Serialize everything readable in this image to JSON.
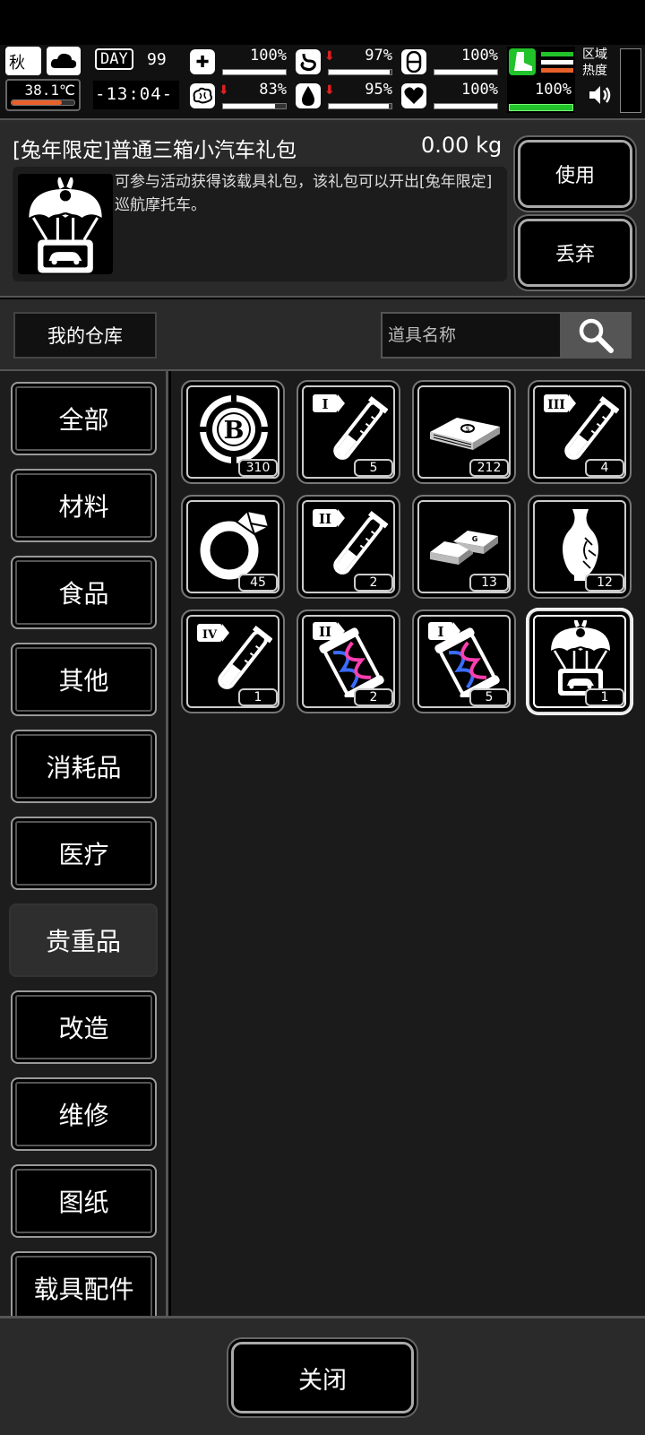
{
  "hud": {
    "season": "秋",
    "temperature": "38.1℃",
    "day_label": "DAY",
    "day": "99",
    "time": "-13:04-",
    "stats": [
      {
        "name": "health",
        "icon": "medkit-icon",
        "value": "100%",
        "fill": 1.0,
        "down": false
      },
      {
        "name": "stomach",
        "icon": "stomach-icon",
        "value": "97%",
        "fill": 0.97,
        "down": true
      },
      {
        "name": "stamina",
        "icon": "capsule-icon",
        "value": "100%",
        "fill": 1.0,
        "down": false
      },
      {
        "name": "mental",
        "icon": "brain-icon",
        "value": "83%",
        "fill": 0.83,
        "down": true
      },
      {
        "name": "thirst",
        "icon": "water-drop-icon",
        "value": "95%",
        "fill": 0.95,
        "down": true
      },
      {
        "name": "heart",
        "icon": "heart-icon",
        "value": "100%",
        "fill": 1.0,
        "down": false
      }
    ],
    "equipment_value": "100%",
    "zone_heat_label": "区域\n热度",
    "zone_label_1": "区域",
    "zone_label_2": "热度"
  },
  "selected_item": {
    "title": "[兔年限定]普通三箱小汽车礼包",
    "weight": "0.00 kg",
    "description": "可参与活动获得该载具礼包，该礼包可以开出[兔年限定]巡航摩托车。",
    "icon": "car-airdrop-icon"
  },
  "actions": {
    "use": "使用",
    "discard": "丢弃"
  },
  "warehouse": {
    "button": "我的仓库",
    "search_placeholder": "道具名称"
  },
  "categories": [
    {
      "label": "全部",
      "active": false
    },
    {
      "label": "材料",
      "active": false
    },
    {
      "label": "食品",
      "active": false
    },
    {
      "label": "其他",
      "active": false
    },
    {
      "label": "消耗品",
      "active": false
    },
    {
      "label": "医疗",
      "active": false
    },
    {
      "label": "贵重品",
      "active": true
    },
    {
      "label": "改造",
      "active": false
    },
    {
      "label": "维修",
      "active": false
    },
    {
      "label": "图纸",
      "active": false
    },
    {
      "label": "载具配件",
      "active": false
    }
  ],
  "items": [
    {
      "icon": "b-coin-icon",
      "count": "310"
    },
    {
      "icon": "test-tube-tier-1-icon",
      "tier": "I",
      "count": "5"
    },
    {
      "icon": "cash-stack-icon",
      "count": "212"
    },
    {
      "icon": "test-tube-tier-3-icon",
      "tier": "III",
      "count": "4"
    },
    {
      "icon": "diamond-ring-icon",
      "count": "45"
    },
    {
      "icon": "test-tube-tier-2-icon",
      "tier": "II",
      "count": "2"
    },
    {
      "icon": "gold-bars-icon",
      "count": "13"
    },
    {
      "icon": "vase-icon",
      "count": "12"
    },
    {
      "icon": "test-tube-tier-4-icon",
      "tier": "IV",
      "count": "1"
    },
    {
      "icon": "dna-capsule-tier-2-icon",
      "tier": "II",
      "count": "2"
    },
    {
      "icon": "dna-capsule-tier-1-icon",
      "tier": "I",
      "count": "5"
    },
    {
      "icon": "car-airdrop-icon",
      "count": "1",
      "selected": true
    }
  ],
  "footer": {
    "close": "关闭"
  },
  "colors": {
    "accent_green": "#22c22a",
    "alert_red": "#e02020",
    "temp_orange": "#e8602a",
    "dna_blue": "#3a6cff",
    "dna_pink": "#ff3fb0"
  }
}
